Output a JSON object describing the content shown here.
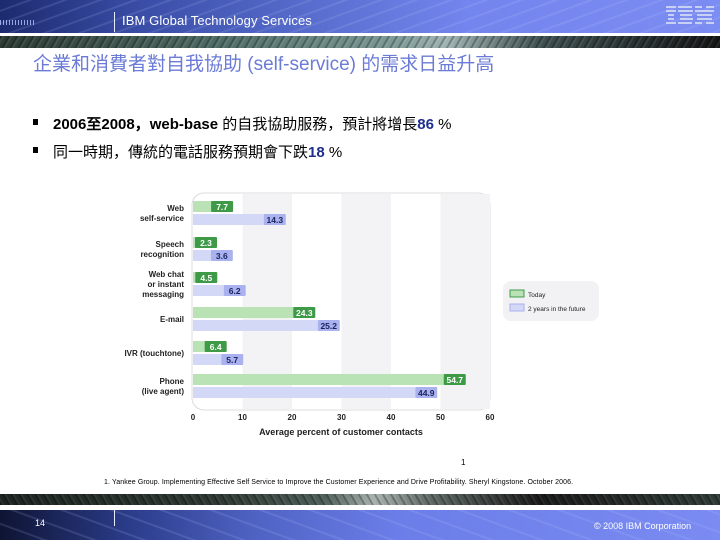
{
  "header": {
    "brand": "IBM Global Technology Services",
    "logo": "IBM"
  },
  "slide": {
    "title": "企業和消費者對自我協助 (self-service) 的需求日益升高",
    "bullets": [
      {
        "parts": [
          {
            "text": "2006至2008，web-base ",
            "style": "bold"
          },
          {
            "text": "的自我協助服務，預計將增長",
            "style": "normal"
          },
          {
            "text": "86",
            "style": "num"
          },
          {
            "text": " %",
            "style": "normal"
          }
        ]
      },
      {
        "parts": [
          {
            "text": "同一時期，傳統的電話服務預期會下跌",
            "style": "normal"
          },
          {
            "text": "18",
            "style": "num"
          },
          {
            "text": " %",
            "style": "normal"
          }
        ]
      }
    ]
  },
  "chart_data": {
    "type": "bar",
    "orientation": "horizontal",
    "title": "",
    "xlabel": "Average percent of customer contacts",
    "ylabel": "",
    "xlim": [
      0,
      60
    ],
    "xticks": [
      0,
      10,
      20,
      30,
      40,
      50,
      60
    ],
    "grid": "alternating vertical bands",
    "legend_position": "right",
    "categories": [
      [
        "Web",
        "self-service"
      ],
      [
        "Speech",
        "recognition"
      ],
      [
        "Web chat",
        "or instant",
        "messaging"
      ],
      [
        "E-mail"
      ],
      [
        "IVR (touchtone)"
      ],
      [
        "Phone",
        "(live agent)"
      ]
    ],
    "series": [
      {
        "name": "Today",
        "color": "#b9e3b4",
        "label_color": "#3e9a47",
        "values": [
          7.7,
          2.3,
          4.5,
          24.3,
          6.4,
          54.7
        ]
      },
      {
        "name": "2 years in the future",
        "color": "#d3d8f7",
        "label_color": "#a9b2ee",
        "values": [
          14.3,
          3.6,
          6.2,
          25.2,
          5.7,
          44.9
        ]
      }
    ]
  },
  "footnote": {
    "marker": "1",
    "text": "1. Yankee Group. Implementing Effective Self Service to Improve the Customer Experience and Drive Profitability. Sheryl  Kingstone. October 2006."
  },
  "footer": {
    "page": "14",
    "copyright": "© 2008 IBM Corporation"
  }
}
